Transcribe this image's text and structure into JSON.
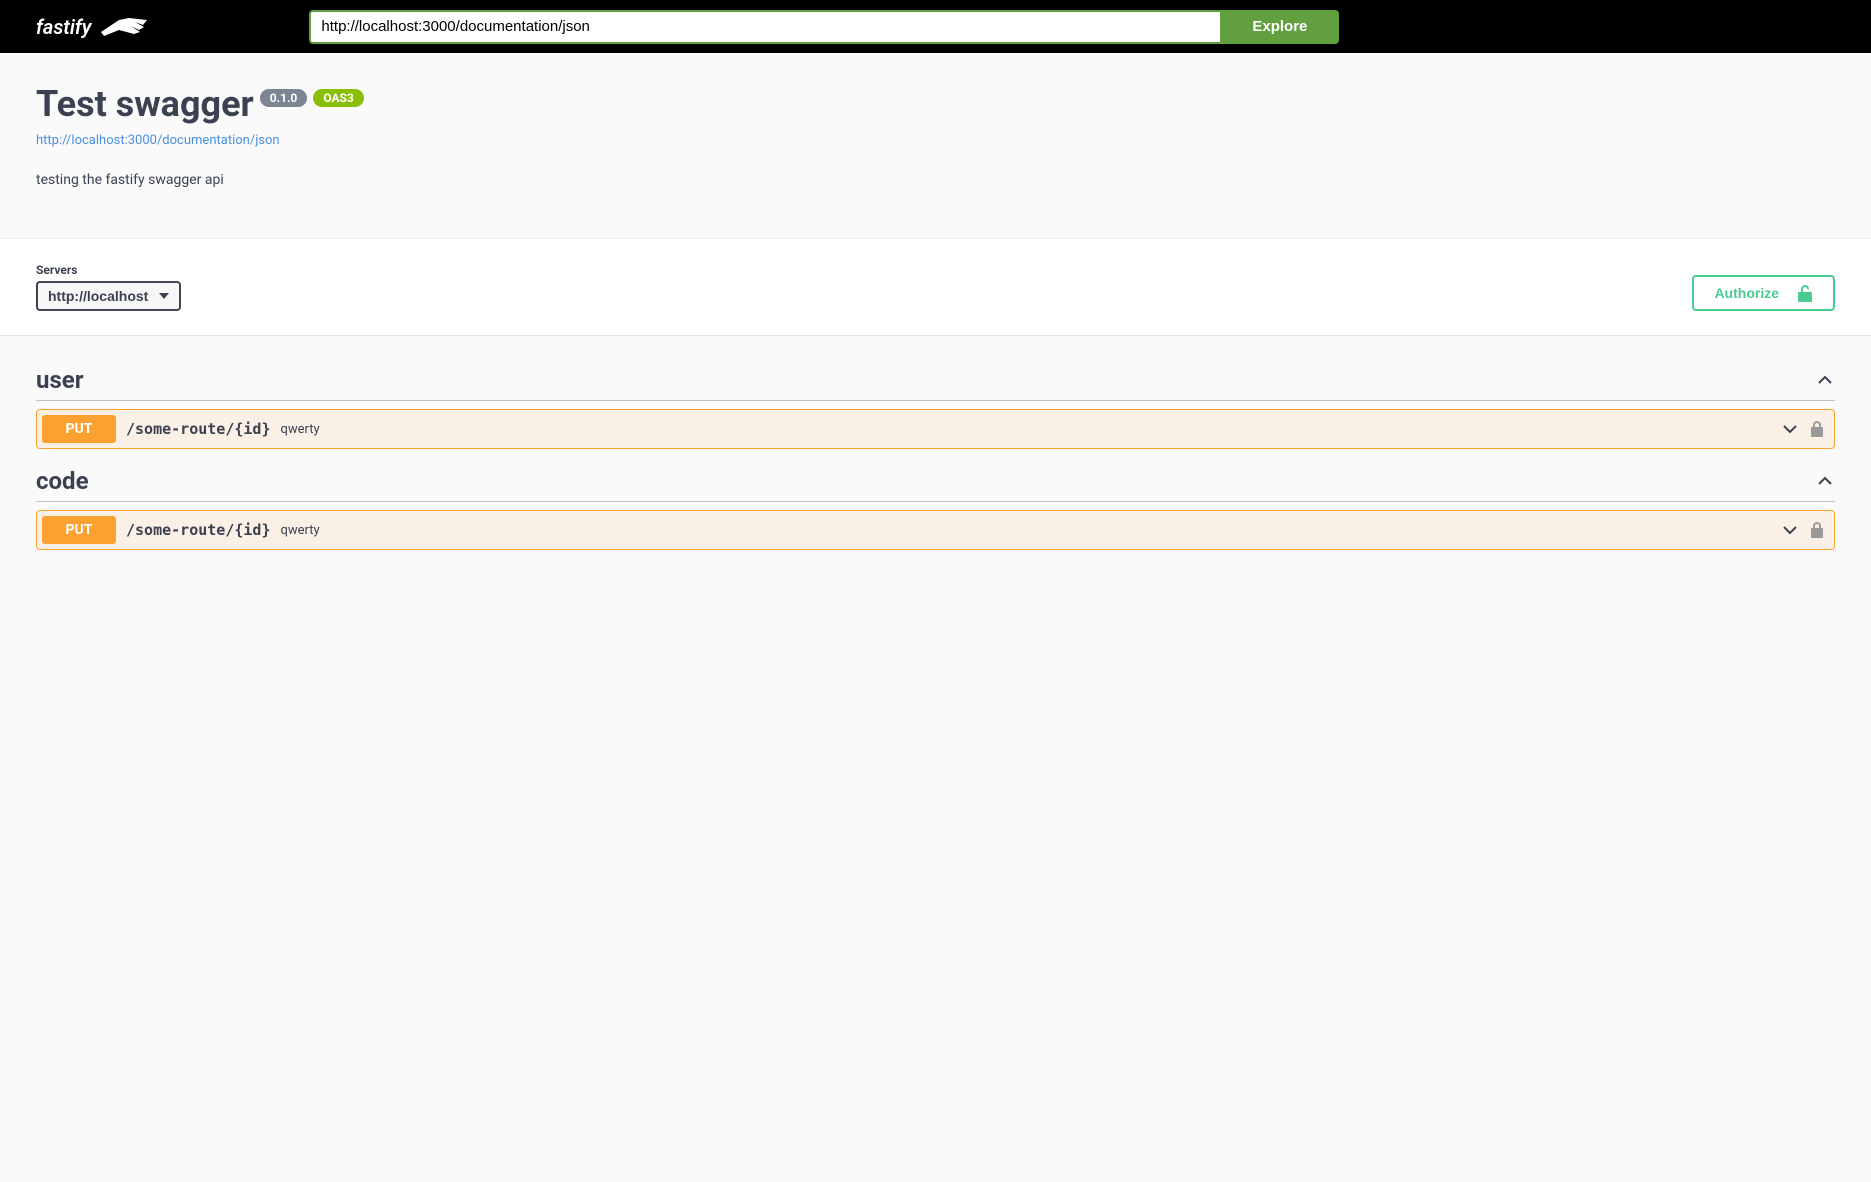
{
  "topbar": {
    "logo_text": "fastify",
    "search_value": "http://localhost:3000/documentation/json",
    "explore_label": "Explore"
  },
  "info": {
    "title": "Test swagger",
    "version": "0.1.0",
    "oas_badge": "OAS3",
    "spec_url": "http://localhost:3000/documentation/json",
    "description": "testing the fastify swagger api"
  },
  "servers": {
    "label": "Servers",
    "selected": "http://localhost"
  },
  "authorize": {
    "label": "Authorize"
  },
  "tags": [
    {
      "name": "user",
      "ops": [
        {
          "method": "PUT",
          "path": "/some-route/{id}",
          "summary": "qwerty"
        }
      ]
    },
    {
      "name": "code",
      "ops": [
        {
          "method": "PUT",
          "path": "/some-route/{id}",
          "summary": "qwerty"
        }
      ]
    }
  ]
}
